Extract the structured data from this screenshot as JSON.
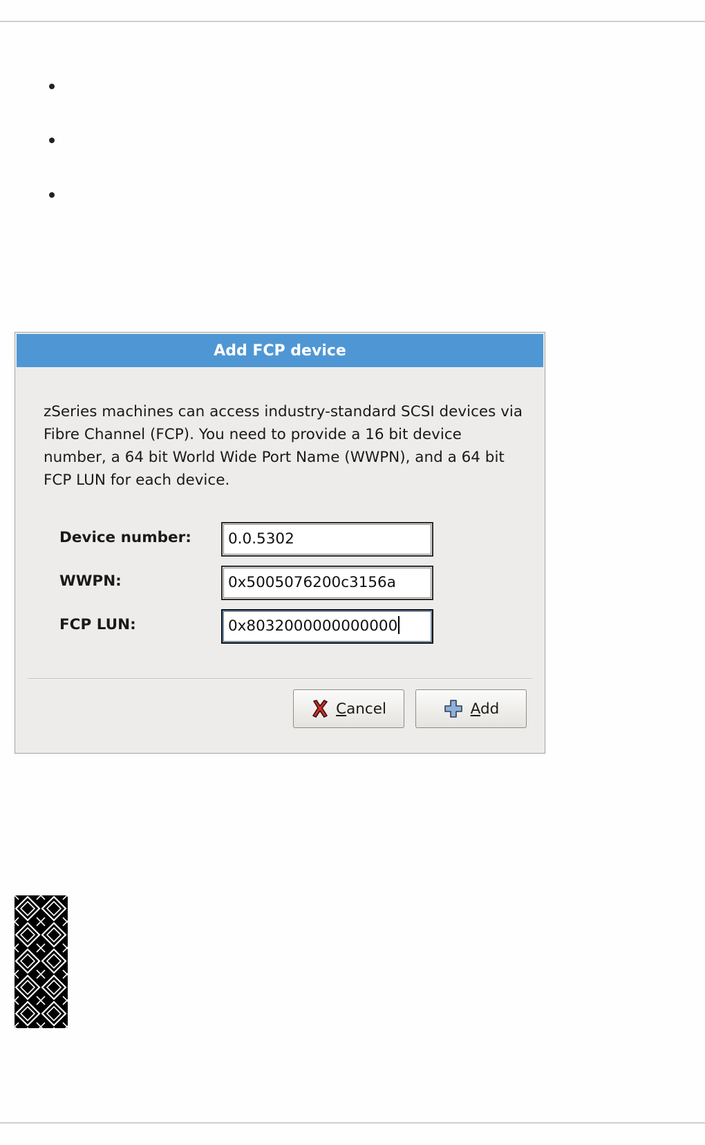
{
  "dialog": {
    "title": "Add FCP device",
    "description": "zSeries machines can access industry-standard SCSI devices via Fibre Channel (FCP). You need to provide a 16 bit device number, a 64 bit World Wide Port Name (WWPN), and a 64 bit FCP LUN for each device.",
    "fields": [
      {
        "label": "Device number:",
        "value": "0.0.5302"
      },
      {
        "label": "WWPN:",
        "value": "0x5005076200c3156a"
      },
      {
        "label": "FCP LUN:",
        "value": "0x8032000000000000"
      }
    ],
    "buttons": {
      "cancel": {
        "mnemonic": "C",
        "rest": "ancel",
        "icon": "cancel-x-icon"
      },
      "add": {
        "mnemonic": "A",
        "rest": "dd",
        "icon": "plus-icon"
      }
    }
  },
  "colors": {
    "titlebar": "#4f97d4",
    "dialog_bg": "#edeceb",
    "page_bg": "#fefefe"
  },
  "icons": {
    "logo": "diamond-pattern-logo"
  }
}
